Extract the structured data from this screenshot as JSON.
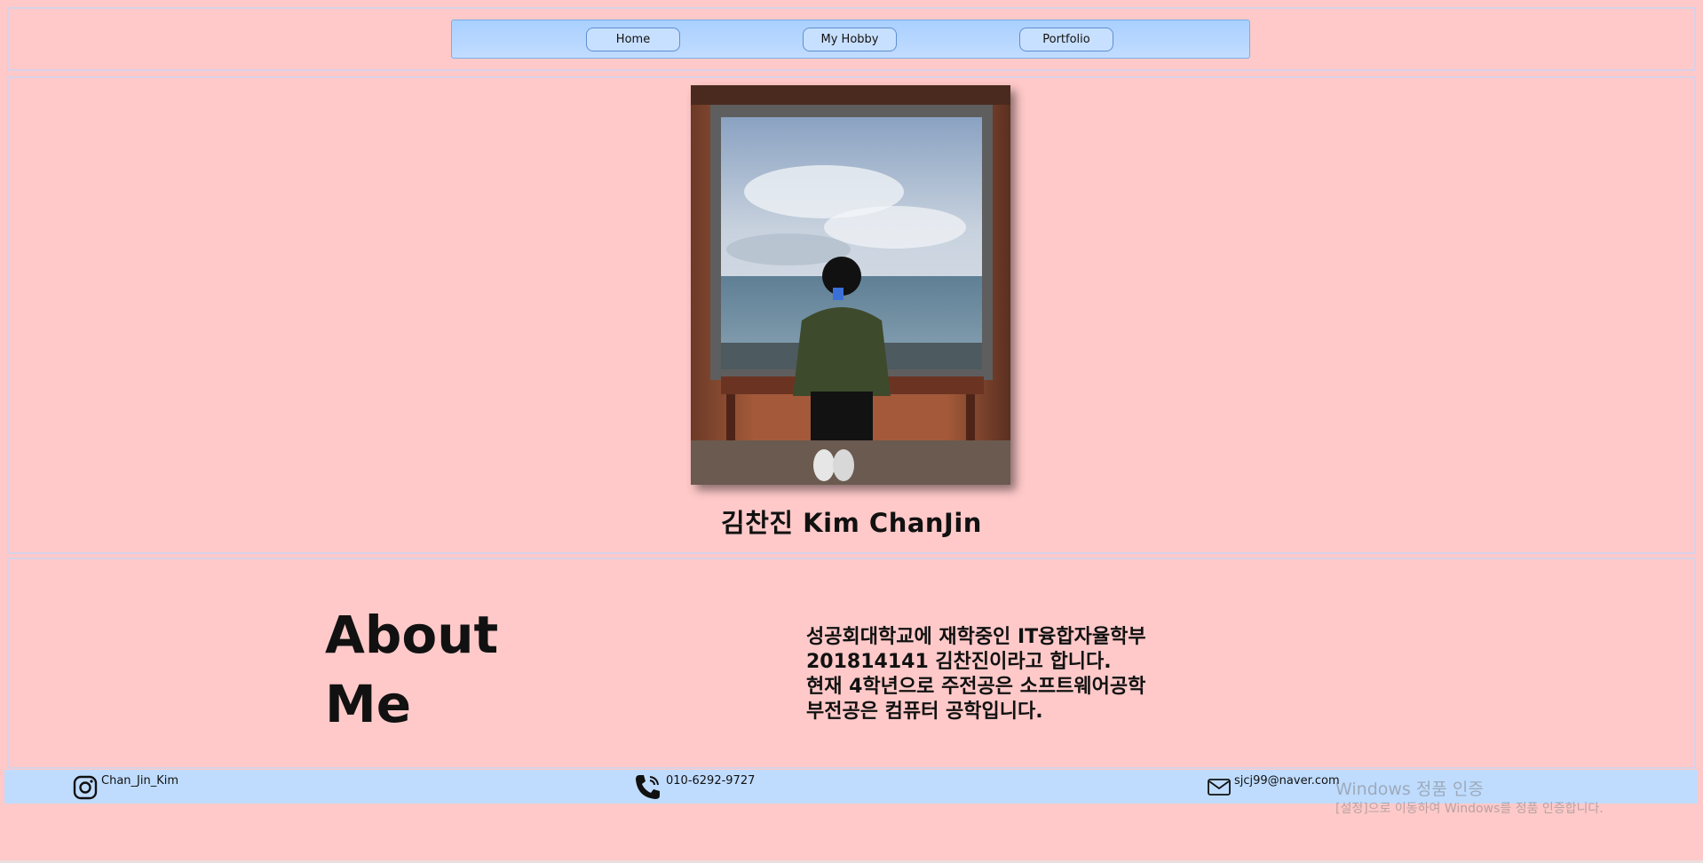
{
  "nav": {
    "items": [
      {
        "label": "Home"
      },
      {
        "label": "My Hobby"
      },
      {
        "label": "Portfolio"
      }
    ]
  },
  "profile": {
    "photo_icon": "profile-photo",
    "name": "김찬진 Kim ChanJin"
  },
  "about": {
    "title_line1": "About",
    "title_line2": "Me",
    "lines": [
      "성공회대학교에 재학중인 IT융합자율학부",
      "201814141 김찬진이라고 합니다.",
      "현재 4학년으로 주전공은 소프트웨어공학",
      "부전공은 컴퓨터 공학입니다."
    ]
  },
  "footer": {
    "instagram": {
      "icon": "instagram-icon",
      "text": "Chan_Jin_Kim"
    },
    "phone": {
      "icon": "phone-icon",
      "text": "010-6292-9727"
    },
    "email": {
      "icon": "mail-icon",
      "text": "sjcj99@naver.com"
    }
  },
  "watermark": {
    "title": "Windows 정품 인증",
    "subtitle": "[설정]으로 이동하여 Windows를 정품 인증합니다."
  },
  "colors": {
    "background": "#ffc9c9",
    "nav": "#b6d6ff",
    "footer": "#bfdcff"
  }
}
